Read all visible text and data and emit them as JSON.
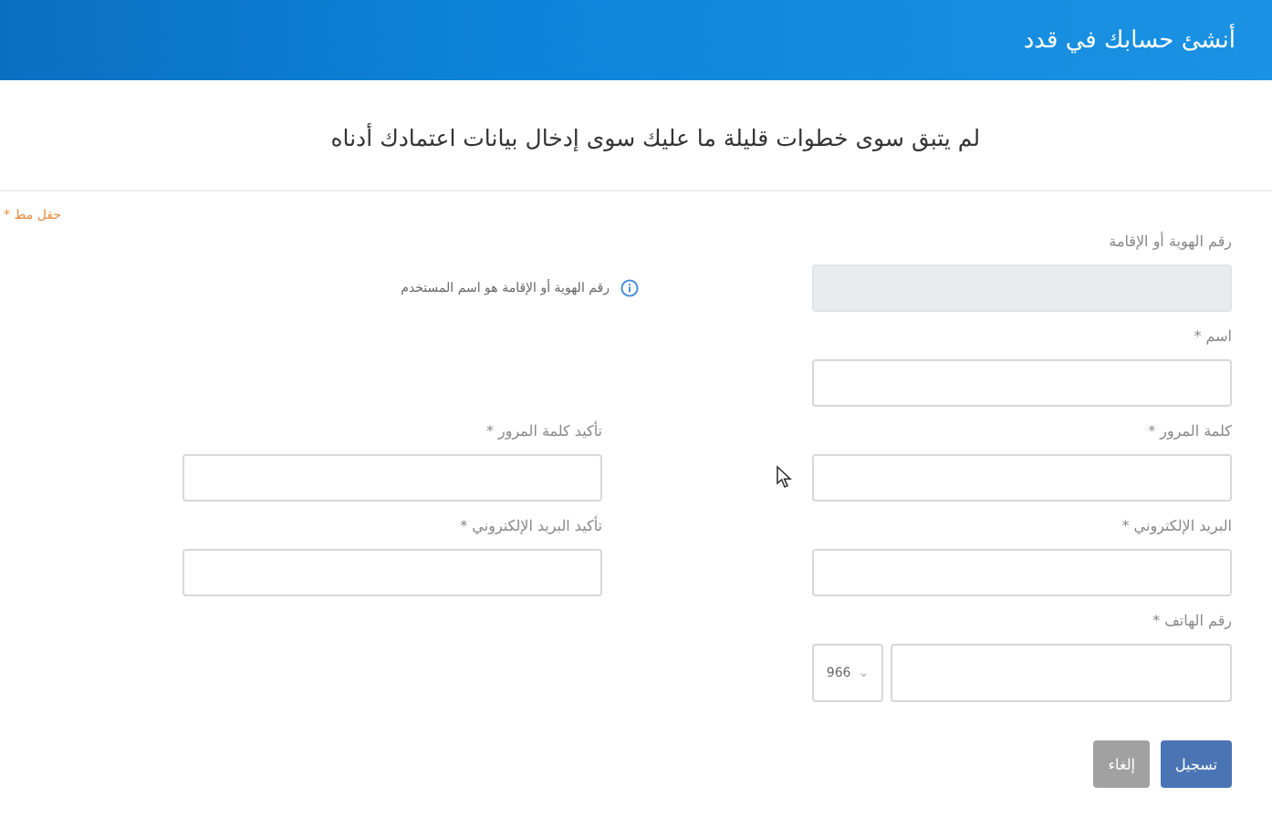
{
  "header": {
    "title": "أنشئ حسابك في قدد"
  },
  "subtitle": "لم يتبق سوى خطوات قليلة ما عليك سوى إدخال بيانات اعتمادك أدناه",
  "required_note": "حقل مط *",
  "id_field": {
    "label": "رقم الهوية أو الإقامة",
    "disabled": true,
    "hint": "رقم الهوية أو الإقامة هو اسم المستخدم"
  },
  "name_field": {
    "label": "اسم *"
  },
  "field_pairs": [
    {
      "right": {
        "label": "كلمة المرور *"
      },
      "left": {
        "label": "تأكيد كلمة المرور *"
      }
    },
    {
      "right": {
        "label": "البريد الإلكتروني *"
      },
      "left": {
        "label": "تأكيد البريد الإلكتروني *"
      }
    }
  ],
  "phone_field": {
    "label": "رقم الهاتف *",
    "country_code": "966",
    "caret": "⌄"
  },
  "buttons": [
    {
      "label": "تسجيل",
      "kind": "primary",
      "disabled": false
    },
    {
      "label": "إلغاء",
      "kind": "secondary",
      "disabled": true
    }
  ]
}
